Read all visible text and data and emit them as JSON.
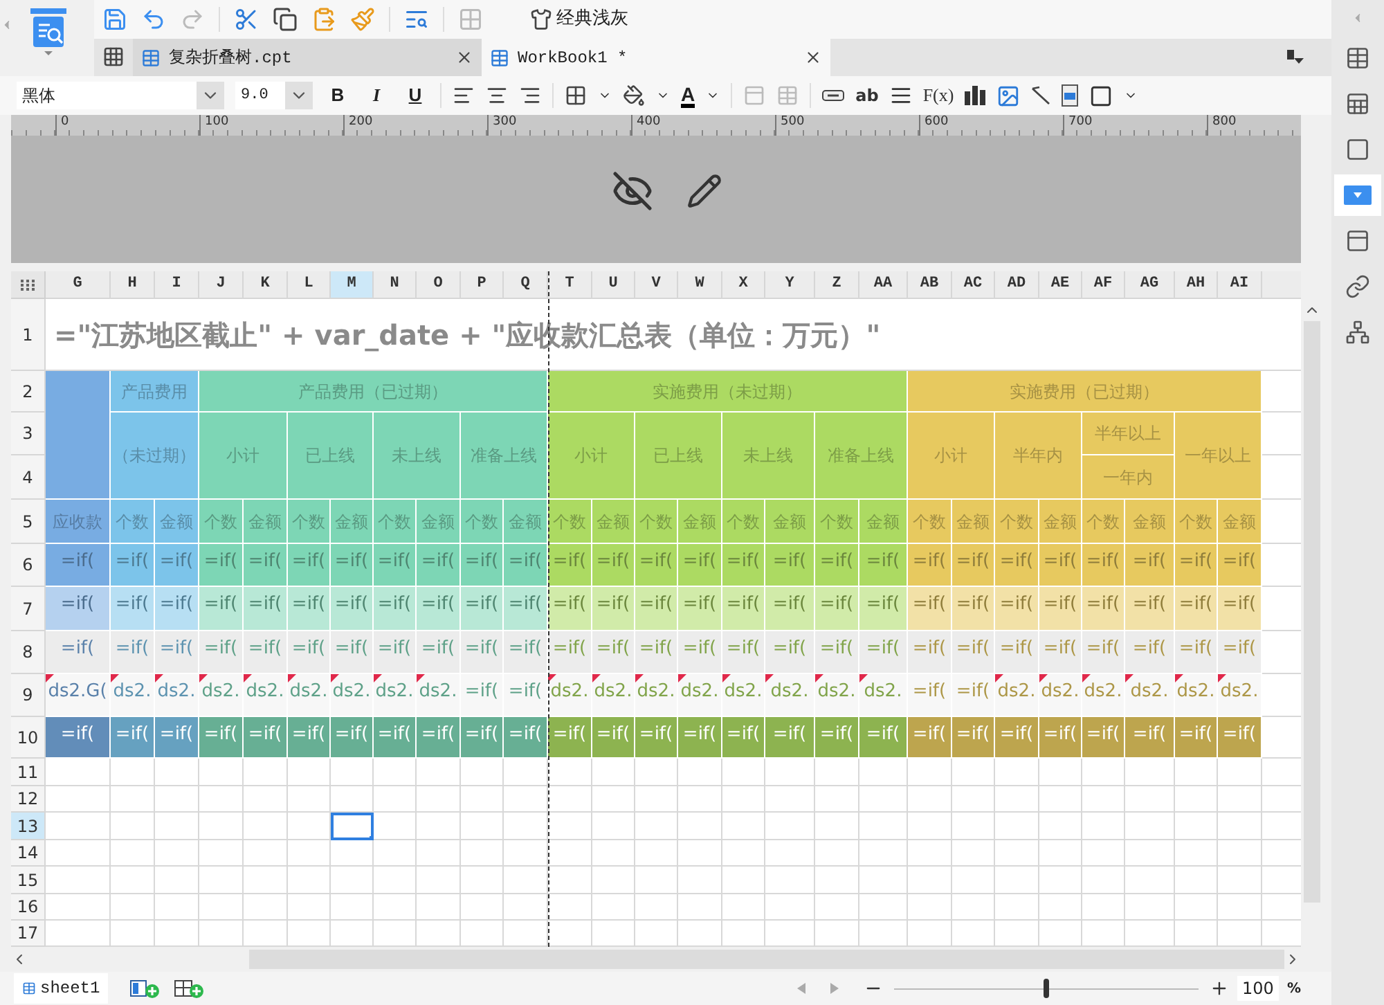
{
  "toolbar": {
    "theme_button": "经典浅灰"
  },
  "tabs": [
    {
      "label": "复杂折叠树.cpt",
      "selected": false
    },
    {
      "label": "WorkBook1 *",
      "selected": true
    }
  ],
  "format_toolbar": {
    "font": "黑体",
    "size": "9.0",
    "bold": "B",
    "italic": "I",
    "underline": "U",
    "font_color": "A",
    "text_tool": "ab",
    "formula": "F(x)"
  },
  "ruler": {
    "ticks": [
      "0",
      "100",
      "200",
      "300",
      "400",
      "500",
      "600",
      "700",
      "800"
    ]
  },
  "sheet": {
    "columns": [
      {
        "label": "G",
        "selected": false
      },
      {
        "label": "H",
        "selected": false
      },
      {
        "label": "I",
        "selected": false
      },
      {
        "label": "J",
        "selected": false
      },
      {
        "label": "K",
        "selected": false
      },
      {
        "label": "L",
        "selected": false
      },
      {
        "label": "M",
        "selected": true
      },
      {
        "label": "N",
        "selected": false
      },
      {
        "label": "O",
        "selected": false
      },
      {
        "label": "P",
        "selected": false
      },
      {
        "label": "Q",
        "selected": false
      },
      {
        "label": "T",
        "selected": false
      },
      {
        "label": "U",
        "selected": false
      },
      {
        "label": "V",
        "selected": false
      },
      {
        "label": "W",
        "selected": false
      },
      {
        "label": "X",
        "selected": false
      },
      {
        "label": "Y",
        "selected": false
      },
      {
        "label": "Z",
        "selected": false
      },
      {
        "label": "AA",
        "selected": false
      },
      {
        "label": "AB",
        "selected": false
      },
      {
        "label": "AC",
        "selected": false
      },
      {
        "label": "AD",
        "selected": false
      },
      {
        "label": "AE",
        "selected": false
      },
      {
        "label": "AF",
        "selected": false
      },
      {
        "label": "AG",
        "selected": false
      },
      {
        "label": "AH",
        "selected": false
      },
      {
        "label": "AI",
        "selected": false
      }
    ],
    "title_row": {
      "number": "1",
      "selected": false,
      "text": "=\"江苏地区截止\" + var_date + \"应收款汇总表（单位：万元）\""
    },
    "header_rows": [
      {
        "number": "2",
        "selected": false,
        "cells": [
          {
            "color": "#78ace2"
          },
          {
            "text": "产品费用",
            "color": "#7cc4ea"
          },
          {
            "text": "产品费用（已过期）",
            "color": "#7dd6b5"
          },
          {
            "text": "实施费用（未过期）",
            "color": "#acda62"
          },
          {
            "text": "实施费用（已过期）",
            "color": "#e7c95f"
          }
        ]
      },
      {
        "number": "3",
        "selected": false,
        "cells": [
          {
            "text": "（未过期）"
          },
          {
            "text": "小计"
          },
          {
            "text": "已上线"
          },
          {
            "text": "未上线"
          },
          {
            "text": "准备上线"
          },
          {
            "text": "小计"
          },
          {
            "text": "已上线"
          },
          {
            "text": "未上线"
          },
          {
            "text": "准备上线"
          },
          {
            "text": "小计"
          },
          {
            "text": "半年内"
          },
          {
            "text": "半年以上"
          },
          {
            "text": "一年以上"
          }
        ]
      },
      {
        "number": "4",
        "selected": false,
        "cells": [
          {
            "text": "一年内"
          }
        ]
      },
      {
        "number": "5",
        "selected": false,
        "cells": [
          {
            "text": "应收款"
          },
          {
            "text": "个数"
          },
          {
            "text": "金额"
          },
          {
            "text": "个数"
          },
          {
            "text": "金额"
          },
          {
            "text": "个数"
          },
          {
            "text": "金额"
          },
          {
            "text": "个数"
          },
          {
            "text": "金额"
          },
          {
            "text": "个数"
          },
          {
            "text": "金额"
          },
          {
            "text": "个数"
          },
          {
            "text": "金额"
          },
          {
            "text": "个数"
          },
          {
            "text": "金额"
          },
          {
            "text": "个数"
          },
          {
            "text": "金额"
          },
          {
            "text": "个数"
          },
          {
            "text": "金额"
          },
          {
            "text": "个数"
          },
          {
            "text": "金额"
          },
          {
            "text": "个数"
          },
          {
            "text": "金额"
          },
          {
            "text": "个数"
          },
          {
            "text": "金额"
          },
          {
            "text": "个数"
          },
          {
            "text": "金额"
          }
        ]
      }
    ],
    "data_rows": [
      {
        "number": "6",
        "selected": false,
        "kind": "base",
        "cells": [
          "=if(",
          "=if(",
          "=if(",
          "=if(",
          "=if(",
          "=if(",
          "=if(",
          "=if(",
          "=if(",
          "=if(",
          "=if(",
          "=if(",
          "=if(",
          "=if(",
          "=if(",
          "=if(",
          "=if(",
          "=if(",
          "=if(",
          "=if(",
          "=if(",
          "=if(",
          "=if(",
          "=if(",
          "=if(",
          "=if(",
          "=if("
        ]
      },
      {
        "number": "7",
        "selected": false,
        "kind": "light",
        "cells": [
          "=if(",
          "=if(",
          "=if(",
          "=if(",
          "=if(",
          "=if(",
          "=if(",
          "=if(",
          "=if(",
          "=if(",
          "=if(",
          "=if(",
          "=if(",
          "=if(",
          "=if(",
          "=if(",
          "=if(",
          "=if(",
          "=if(",
          "=if(",
          "=if(",
          "=if(",
          "=if(",
          "=if(",
          "=if(",
          "=if(",
          "=if("
        ]
      },
      {
        "number": "8",
        "selected": false,
        "kind": "gray",
        "cells": [
          "=if(",
          "=if(",
          "=if(",
          "=if(",
          "=if(",
          "=if(",
          "=if(",
          "=if(",
          "=if(",
          "=if(",
          "=if(",
          "=if(",
          "=if(",
          "=if(",
          "=if(",
          "=if(",
          "=if(",
          "=if(",
          "=if(",
          "=if(",
          "=if(",
          "=if(",
          "=if(",
          "=if(",
          "=if(",
          "=if(",
          "=if("
        ]
      },
      {
        "number": "9",
        "selected": false,
        "kind": "white",
        "cells": [
          "ds2.G(",
          "ds2.",
          "ds2.",
          "ds2.",
          "ds2.",
          "ds2.",
          "ds2.",
          "ds2.",
          "ds2.",
          "=if(",
          "=if(",
          "ds2.",
          "ds2.",
          "ds2.",
          "ds2.",
          "ds2.",
          "ds2.",
          "ds2.",
          "ds2.",
          "=if(",
          "=if(",
          "ds2.",
          "ds2.",
          "ds2.",
          "ds2.",
          "ds2.",
          "ds2."
        ],
        "flagged": [
          true,
          true,
          true,
          true,
          true,
          true,
          true,
          true,
          true,
          false,
          false,
          true,
          true,
          true,
          true,
          true,
          true,
          true,
          true,
          false,
          false,
          true,
          true,
          true,
          true,
          true,
          true
        ]
      },
      {
        "number": "10",
        "selected": false,
        "kind": "dark",
        "cells": [
          "=if(",
          "=if(",
          "=if(",
          "=if(",
          "=if(",
          "=if(",
          "=if(",
          "=if(",
          "=if(",
          "=if(",
          "=if(",
          "=if(",
          "=if(",
          "=if(",
          "=if(",
          "=if(",
          "=if(",
          "=if(",
          "=if(",
          "=if(",
          "=if(",
          "=if(",
          "=if(",
          "=if(",
          "=if(",
          "=if(",
          "=if("
        ]
      }
    ],
    "blank_rows": [
      {
        "number": "11",
        "selected": false
      },
      {
        "number": "12",
        "selected": false
      },
      {
        "number": "13",
        "selected": true
      },
      {
        "number": "14",
        "selected": false
      },
      {
        "number": "15",
        "selected": false
      },
      {
        "number": "16",
        "selected": false
      },
      {
        "number": "17",
        "selected": false
      }
    ]
  },
  "sheet_tabs": [
    {
      "label": "sheet1",
      "selected": true
    }
  ],
  "zoom": {
    "level": 0.5,
    "value": "100",
    "unit": "%"
  },
  "side_panel": {
    "items": [
      {
        "selected": false
      },
      {
        "selected": false
      },
      {
        "selected": false
      },
      {
        "selected": true
      },
      {
        "selected": false
      },
      {
        "selected": false
      },
      {
        "selected": false
      }
    ]
  }
}
